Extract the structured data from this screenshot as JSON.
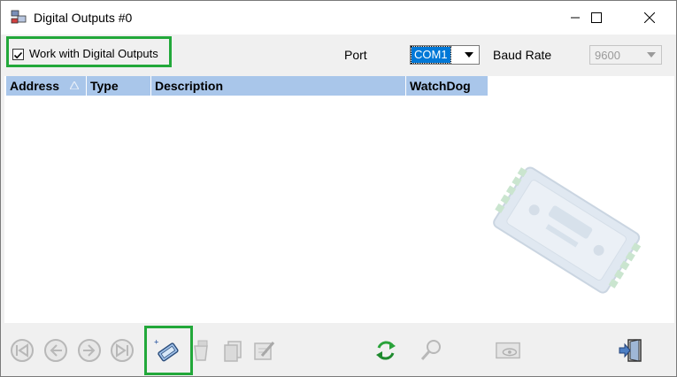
{
  "window": {
    "title": "Digital Outputs #0",
    "controls": {
      "minimize": "minimize-icon",
      "maximize": "maximize-icon",
      "close": "close-icon"
    }
  },
  "toolbar": {
    "work_checkbox": {
      "label": "Work with Digital Outputs",
      "checked": true
    },
    "port": {
      "label": "Port",
      "value": "COM1"
    },
    "baud_rate": {
      "label": "Baud Rate",
      "value": "9600",
      "enabled": false
    }
  },
  "grid": {
    "columns": [
      {
        "label": "Address",
        "sorted": "ascending"
      },
      {
        "label": "Type"
      },
      {
        "label": "Description"
      },
      {
        "label": "WatchDog"
      }
    ],
    "rows": []
  },
  "bottom_toolbar": {
    "buttons": [
      {
        "icon": "first-record-icon",
        "enabled": false
      },
      {
        "icon": "previous-record-icon",
        "enabled": false
      },
      {
        "icon": "next-record-icon",
        "enabled": false
      },
      {
        "icon": "last-record-icon",
        "enabled": false
      },
      {
        "icon": "new-module-icon",
        "enabled": true,
        "highlighted": true
      },
      {
        "icon": "delete-icon",
        "enabled": false
      },
      {
        "icon": "copy-icon",
        "enabled": false
      },
      {
        "icon": "edit-icon",
        "enabled": false
      },
      {
        "icon": "refresh-icon",
        "enabled": true
      },
      {
        "icon": "search-icon",
        "enabled": false
      },
      {
        "icon": "view-icon",
        "enabled": false
      },
      {
        "icon": "exit-icon",
        "enabled": true
      }
    ]
  },
  "colors": {
    "highlight_border": "#22a83a",
    "grid_header": "#a9c6ea",
    "selection": "#0078d7"
  }
}
